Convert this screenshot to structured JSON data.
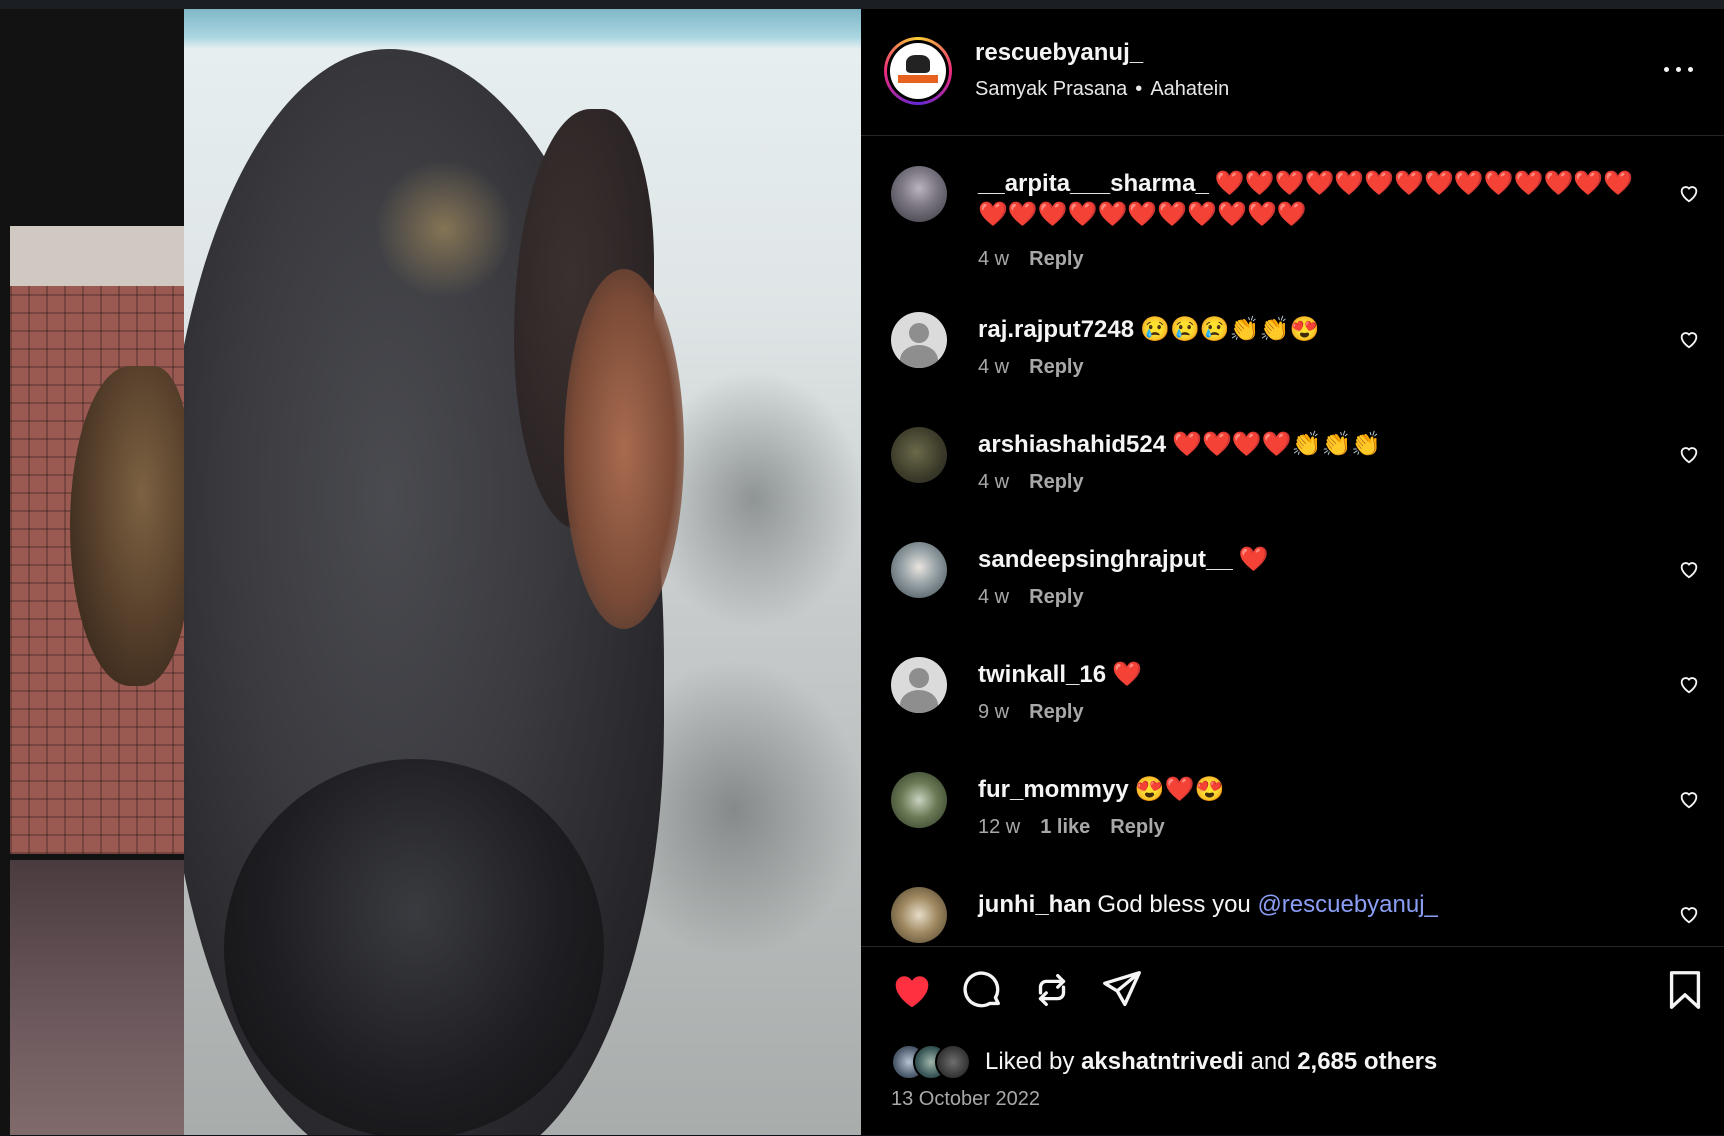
{
  "post": {
    "username": "rescuebyanuj_",
    "audio_artist": "Samyak Prasana",
    "separator": "•",
    "audio_track": "Aahatein",
    "more_icon": "more-horizontal-icon"
  },
  "comments": [
    {
      "user": "__arpita___sharma_",
      "text": "❤️❤️❤️❤️❤️❤️❤️❤️❤️❤️❤️❤️❤️❤️❤️❤️❤️❤️❤️❤️❤️❤️❤️❤️❤️",
      "time": "4 w",
      "likes": "",
      "reply": "Reply",
      "avatar": "photo"
    },
    {
      "user": "raj.rajput7248",
      "text": "😢😢😢👏👏😍",
      "time": "4 w",
      "likes": "",
      "reply": "Reply",
      "avatar": "default"
    },
    {
      "user": "arshiashahid524",
      "text": "❤️❤️❤️❤️👏👏👏",
      "time": "4 w",
      "likes": "",
      "reply": "Reply",
      "avatar": "photo"
    },
    {
      "user": "sandeepsinghrajput__",
      "text": "❤️",
      "time": "4 w",
      "likes": "",
      "reply": "Reply",
      "avatar": "photo"
    },
    {
      "user": "twinkall_16",
      "text": "❤️",
      "time": "9 w",
      "likes": "",
      "reply": "Reply",
      "avatar": "default"
    },
    {
      "user": "fur_mommyy",
      "text": "😍❤️😍",
      "time": "12 w",
      "likes": "1 like",
      "reply": "Reply",
      "avatar": "photo"
    },
    {
      "user": "junhi_han",
      "text": "God bless you",
      "mention": "@rescuebyanuj_",
      "time": "",
      "likes": "",
      "reply": "",
      "avatar": "photo"
    }
  ],
  "actions": {
    "like_icon": "heart-filled-icon",
    "comment_icon": "comment-icon",
    "repost_icon": "repost-icon",
    "share_icon": "share-icon",
    "save_icon": "bookmark-icon",
    "like_color": "#ff3040"
  },
  "likes": {
    "prefix": "Liked by",
    "liker": "akshatntrivedi",
    "joiner": "and",
    "others": "2,685 others"
  },
  "date": "13 October 2022"
}
